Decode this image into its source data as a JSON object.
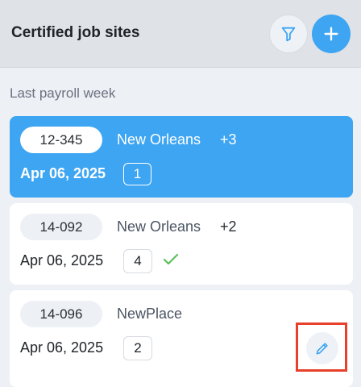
{
  "header": {
    "title": "Certified job sites",
    "filter_icon": "filter-icon",
    "add_icon": "plus-icon"
  },
  "section_label": "Last payroll week",
  "cards": [
    {
      "code": "12-345",
      "location": "New Orleans",
      "extra": "+3",
      "date": "Apr 06, 2025",
      "count": "1",
      "selected": true
    },
    {
      "code": "14-092",
      "location": "New Orleans",
      "extra": "+2",
      "date": "Apr 06, 2025",
      "count": "4",
      "status_icon": "check-icon"
    },
    {
      "code": "14-096",
      "location": "NewPlace",
      "extra": "",
      "date": "Apr 06, 2025",
      "count": "2",
      "action_icon": "pencil-icon"
    }
  ],
  "colors": {
    "accent": "#3da5f2",
    "check": "#5cc05a",
    "highlight": "#e8402a"
  }
}
